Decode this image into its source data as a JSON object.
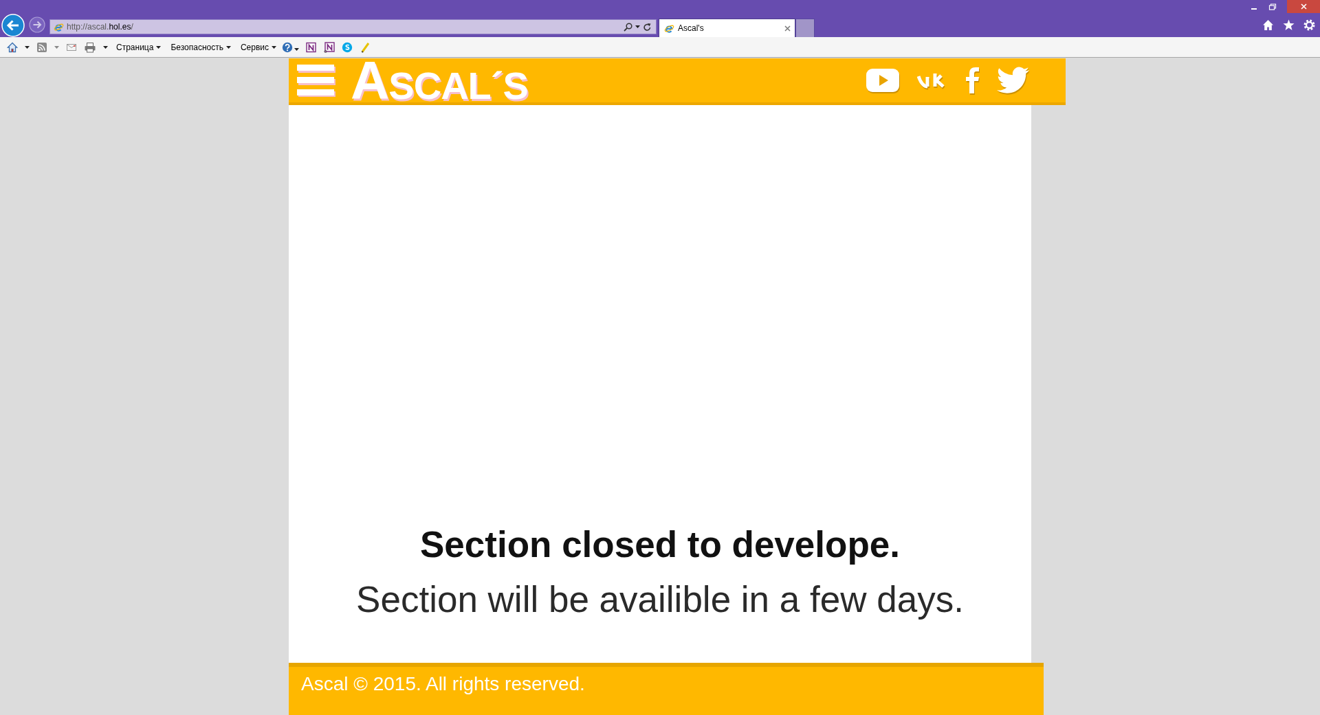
{
  "browser": {
    "address_bar": {
      "url": "http://ascal.**hol.es**/"
    },
    "tabs": [
      {
        "title": "Ascal's",
        "selected": true
      }
    ],
    "command_bar": {
      "menus": [
        {
          "label": "Страница"
        },
        {
          "label": "Безопасность"
        },
        {
          "label": "Сервис"
        }
      ]
    }
  },
  "site": {
    "header": {
      "logo": "ASCAL´S"
    },
    "content": {
      "heading": "Section closed to develope.",
      "message": "Section will be availible in a few days."
    },
    "footer": {
      "copyright": "Ascal © 2015. All rights reserved."
    }
  }
}
